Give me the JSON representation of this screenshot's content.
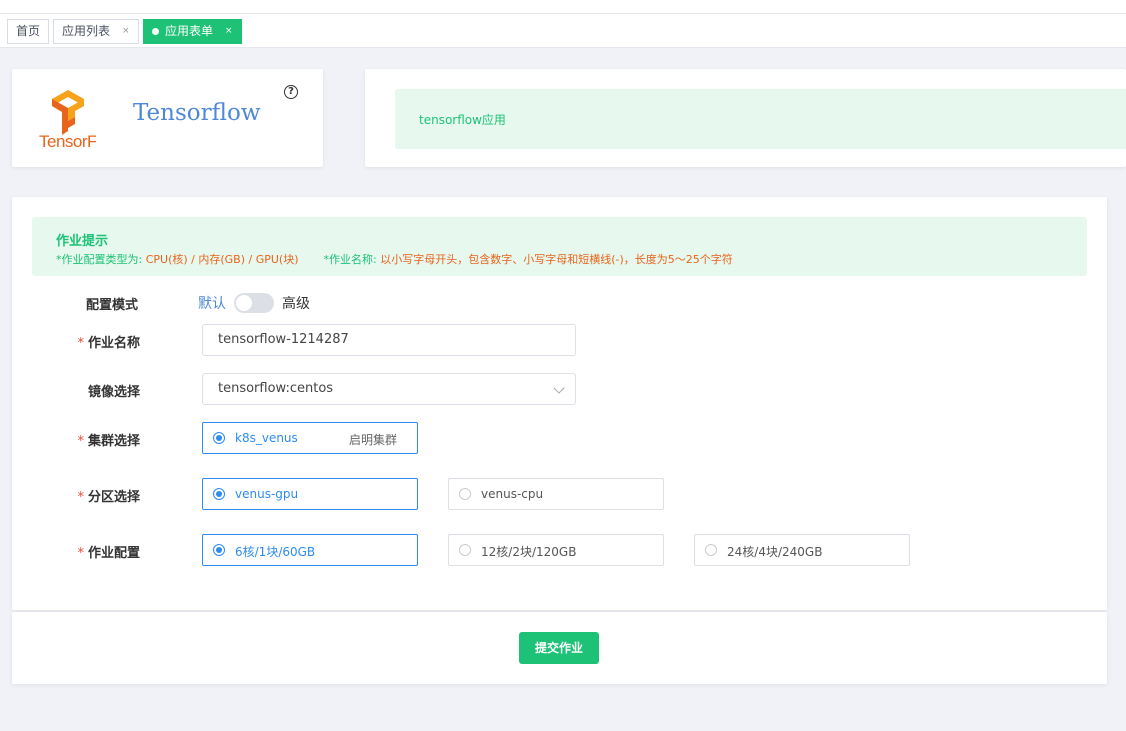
{
  "tabs": [
    {
      "label": "首页"
    },
    {
      "label": "应用列表",
      "close": "×"
    },
    {
      "label": "应用表单",
      "close": "×"
    }
  ],
  "app": {
    "logo_text": "TensorFlow",
    "title": "Tensorflow",
    "help_glyph": "?",
    "description": "tensorflow应用"
  },
  "tip": {
    "title": "作业提示",
    "line1_label": "*作业配置类型为: ",
    "line1_value": "CPU(核) / 内存(GB) / GPU(块)",
    "line2_label": "*作业名称: ",
    "line2_value": "以小写字母开头，包含数字、小写字母和短横线(-)，长度为5～25个字符"
  },
  "form": {
    "mode_label": "配置模式",
    "mode_default": "默认",
    "mode_advanced": "高级",
    "job_name_label": "作业名称",
    "job_name_value": "tensorflow-1214287",
    "image_label": "镜像选择",
    "image_value": "tensorflow:centos",
    "cluster_label": "集群选择",
    "cluster_option": {
      "name": "k8s_venus",
      "desc": "启明集群"
    },
    "partition_label": "分区选择",
    "partition_options": [
      "venus-gpu",
      "venus-cpu"
    ],
    "config_label": "作业配置",
    "config_options": [
      "6核/1块/60GB",
      "12核/2块/120GB",
      "24核/4块/240GB"
    ]
  },
  "submit_label": "提交作业",
  "colors": {
    "accent": "#1ec276",
    "primary": "#2d8cf0",
    "warning": "#e8641b",
    "required": "#e74c3c"
  }
}
